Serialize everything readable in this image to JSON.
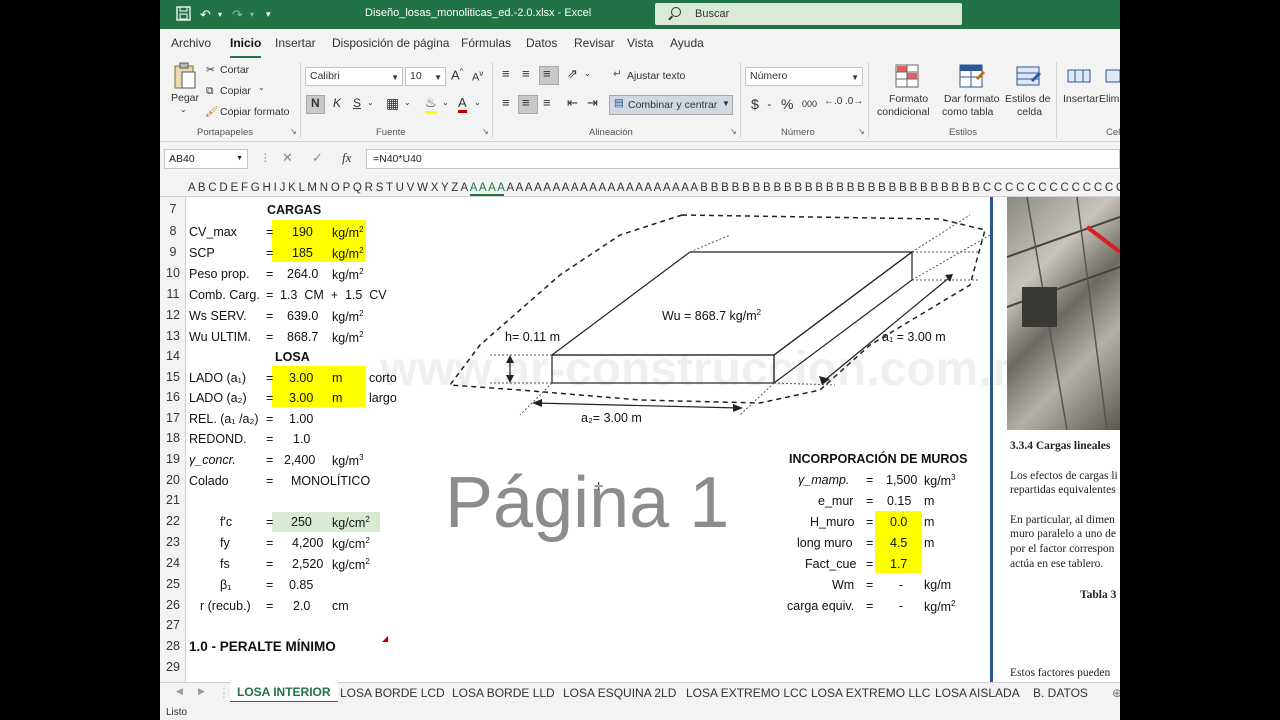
{
  "titlebar": {
    "title": "Diseño_losas_monoliticas_ed.-2.0.xlsx  -  Excel",
    "search": "Buscar"
  },
  "menu": [
    "Archivo",
    "Inicio",
    "Insertar",
    "Disposición de página",
    "Fórmulas",
    "Datos",
    "Revisar",
    "Vista",
    "Ayuda"
  ],
  "ribbon": {
    "pegar": "Pegar",
    "cortar": "Cortar",
    "copiar": "Copiar",
    "copiar_formato": "Copiar formato",
    "portapapeles": "Portapapeles",
    "font": "Calibri",
    "size": "10",
    "fuente": "Fuente",
    "bold": "N",
    "italic": "K",
    "underline": "S",
    "ajustar": "Ajustar texto",
    "combinar": "Combinar y centrar",
    "alineacion": "Alineación",
    "numfmt": "Número",
    "numero": "Número",
    "currency": "$",
    "percent": "%",
    "thousands": "000",
    "formato_cond_1": "Formato",
    "formato_cond_2": "condicional",
    "dar_formato_1": "Dar formato",
    "dar_formato_2": "como tabla",
    "estilos_celda_1": "Estilos de",
    "estilos_celda_2": "celda",
    "estilos": "Estilos",
    "insertar": "Insertar",
    "eliminar": "Elim",
    "celdas": "Cel"
  },
  "formula": {
    "namebox": "AB40",
    "fx": "fx",
    "value": "=N40*U40"
  },
  "columns": {
    "pre": "A B C D E F G H I J K L M N O P Q R S  T  U V W X Y Z A ",
    "sel": "A A A A",
    "post": "  A A A A A A A A A A A A A A A A A A A A A B B B B B B B B B B B B B B B B B B B B B B B B B B B C C C C C C C C C C C C C C C C C C C C C C C"
  },
  "rows": [
    "7",
    "8",
    "9",
    "10",
    "11",
    "12",
    "13",
    "14",
    "15",
    "16",
    "17",
    "18",
    "19",
    "20",
    "21",
    "22",
    "23",
    "24",
    "25",
    "26",
    "27",
    "28",
    "29"
  ],
  "cargas": {
    "title": "CARGAS",
    "items": [
      {
        "label": "CV_max",
        "eq": "=",
        "value": "190",
        "unit": "kg/m",
        "sup": "2"
      },
      {
        "label": "SCP",
        "eq": "=",
        "value": "185",
        "unit": "kg/m",
        "sup": "2"
      },
      {
        "label": "Peso prop.",
        "eq": "=",
        "value": "264.0",
        "unit": "kg/m",
        "sup": "2"
      },
      {
        "label": "Comb. Carg.",
        "eq": "=",
        "value": "1.3  CM  +  1.5  CV",
        "unit": "",
        "sup": ""
      },
      {
        "label": "Ws SERV.",
        "eq": "=",
        "value": "639.0",
        "unit": "kg/m",
        "sup": "2"
      },
      {
        "label": "Wu ULTIM.",
        "eq": "=",
        "value": "868.7",
        "unit": "kg/m",
        "sup": "2"
      }
    ]
  },
  "losa": {
    "title": "LOSA",
    "items": [
      {
        "label": "LADO (a₁)",
        "eq": "=",
        "value": "3.00",
        "unit": "m",
        "extra": "corto"
      },
      {
        "label": "LADO (a₂)",
        "eq": "=",
        "value": "3.00",
        "unit": "m",
        "extra": "largo"
      },
      {
        "label": "REL. (a₁ /a₂)",
        "eq": "=",
        "value": "1.00",
        "unit": "",
        "extra": ""
      },
      {
        "label": "REDOND.",
        "eq": "=",
        "value": "1.0",
        "unit": "",
        "extra": ""
      },
      {
        "label": "γ_concr.",
        "eq": "=",
        "value": "2,400",
        "unit": "kg/m",
        "sup": "3",
        "extra": ""
      },
      {
        "label": "Colado",
        "eq": "=",
        "value": "MONOLÍTICO",
        "unit": "",
        "extra": ""
      }
    ]
  },
  "materiales": [
    {
      "label": "f'c",
      "eq": "=",
      "value": "250",
      "unit": "kg/cm",
      "sup": "2"
    },
    {
      "label": "fy",
      "eq": "=",
      "value": "4,200",
      "unit": "kg/cm",
      "sup": "2"
    },
    {
      "label": "fs",
      "eq": "=",
      "value": "2,520",
      "unit": "kg/cm",
      "sup": "2"
    },
    {
      "label": "β₁",
      "eq": "=",
      "value": "0.85",
      "unit": "",
      "sup": ""
    },
    {
      "label": "r (recub.)",
      "eq": "=",
      "value": "2.0",
      "unit": "cm",
      "sup": ""
    }
  ],
  "section_title": "1.0 - PERALTE MÍNIMO",
  "diagram": {
    "wu": "Wu  =  868.7  kg/m",
    "wu_sup": "2",
    "h": "h=  0.11   m",
    "a1": "a₁ =  3.00   m",
    "a2": "a₂=   3.00     m"
  },
  "watermark": "www.ar-construccion.com.mx",
  "page_label": "Página 1",
  "muros": {
    "title": "INCORPORACIÓN DE MUROS",
    "items": [
      {
        "label": "γ_mamp.",
        "eq": "=",
        "value": "1,500",
        "unit": "kg/m",
        "sup": "3"
      },
      {
        "label": "e_mur",
        "eq": "=",
        "value": "0.15",
        "unit": "m",
        "sup": ""
      },
      {
        "label": "H_muro",
        "eq": "=",
        "value": "0.0",
        "unit": "m",
        "sup": ""
      },
      {
        "label": "long muro",
        "eq": "=",
        "value": "4.5",
        "unit": "m",
        "sup": ""
      },
      {
        "label": "Fact_cue",
        "eq": "=",
        "value": "1.7",
        "unit": "",
        "sup": ""
      },
      {
        "label": "Wm",
        "eq": "=",
        "value": "-",
        "unit": "kg/m",
        "sup": ""
      },
      {
        "label": "carga equiv.",
        "eq": "=",
        "value": "-",
        "unit": "kg/m",
        "sup": "2"
      }
    ]
  },
  "doc": {
    "heading": "3.3.4 Cargas lineales",
    "l1": "Los efectos de cargas li",
    "l2": "repartidas equivalentes",
    "l3": "En particular, al dimen",
    "l4": "muro paralelo a uno de",
    "l5": "por el factor correspon",
    "l6": "actúa en ese tablero.",
    "tabla": "Tabla 3",
    "l7": "Estos factores pueden"
  },
  "tabs": [
    "LOSA INTERIOR",
    "LOSA BORDE LCD",
    "LOSA BORDE LLD",
    "LOSA ESQUINA 2LD",
    "LOSA EXTREMO LCC",
    "LOSA EXTREMO LLC",
    "LOSA AISLADA",
    "B. DATOS"
  ],
  "status": "Listo",
  "colors": {
    "accent": "#217346",
    "highlight": "#ffff00",
    "green_fill": "#d9ead3"
  }
}
